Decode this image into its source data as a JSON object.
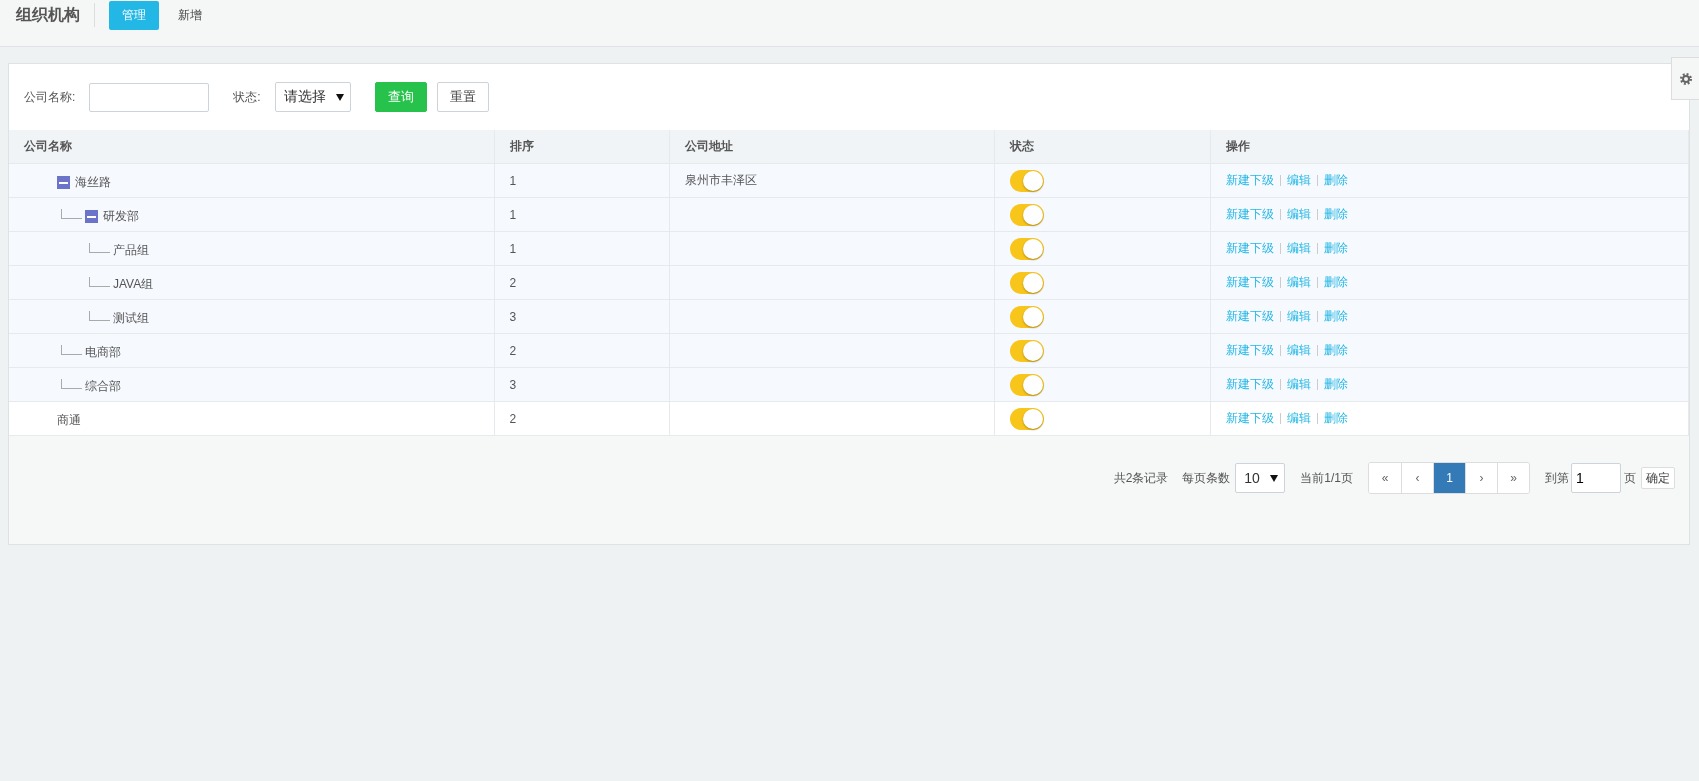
{
  "header": {
    "title": "组织机构",
    "tabs": [
      {
        "label": "管理",
        "selected": true
      },
      {
        "label": "新增",
        "selected": false
      }
    ]
  },
  "filters": {
    "name_label": "公司名称:",
    "status_label": "状态:",
    "status_value": "请选择",
    "buttons": [
      "查询",
      "重置"
    ]
  },
  "table": {
    "columns": [
      "公司名称",
      "排序",
      "公司地址",
      "状态",
      "操作"
    ],
    "rows": [
      {
        "name": "海丝路",
        "order": "1",
        "address": "泉州市丰泽区",
        "on": true,
        "expanded": true,
        "actions": [
          "新建下级",
          "编辑",
          "删除"
        ],
        "children": [
          {
            "name": "研发部",
            "order": "1",
            "on": true,
            "expanded": true,
            "actions": [
              "新建下级",
              "编辑",
              "删除"
            ],
            "children": [
              {
                "name": "产品组",
                "order": "1",
                "on": true,
                "actions": [
                  "新建下级",
                  "编辑",
                  "删除"
                ]
              },
              {
                "name": "JAVA组",
                "order": "2",
                "on": true,
                "actions": [
                  "新建下级",
                  "编辑",
                  "删除"
                ]
              },
              {
                "name": "测试组",
                "order": "3",
                "on": true,
                "actions": [
                  "新建下级",
                  "编辑",
                  "删除"
                ]
              }
            ]
          },
          {
            "name": "电商部",
            "order": "2",
            "on": true,
            "actions": [
              "新建下级",
              "编辑",
              "删除"
            ]
          },
          {
            "name": "综合部",
            "order": "3",
            "on": true,
            "actions": [
              "新建下级",
              "编辑",
              "删除"
            ]
          }
        ]
      },
      {
        "name": "商通",
        "order": "2",
        "on": true,
        "actions": [
          "新建下级",
          "编辑",
          "删除"
        ]
      }
    ]
  },
  "pagination": {
    "total": "共2条记录",
    "per_page_label": "每页条数",
    "per_page": "10",
    "current": "当前1/1页",
    "pages": [
      {
        "label": "«",
        "selected": false
      },
      {
        "label": "‹",
        "selected": false
      },
      {
        "label": "1",
        "selected": true
      },
      {
        "label": "›",
        "selected": false
      },
      {
        "label": "»",
        "selected": false
      }
    ],
    "goto_label": "到第",
    "goto_value": "1",
    "page_unit": "页",
    "confirm": "确定"
  }
}
